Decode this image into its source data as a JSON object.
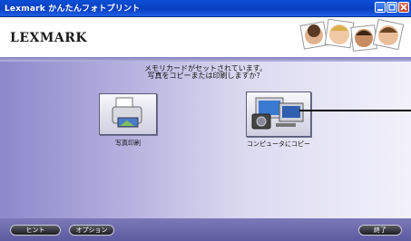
{
  "window": {
    "title": "Lexmark かんたんフォトプリント"
  },
  "header": {
    "logo": "LEXMARK"
  },
  "main": {
    "prompt_line1": "メモリカードがセットされています。",
    "prompt_line2": "写真をコピーまたは印刷しますか？",
    "options": [
      {
        "label": "写真印刷",
        "icon": "printer-icon"
      },
      {
        "label": "コンピュータにコピー",
        "icon": "computer-copy-icon"
      }
    ]
  },
  "footer": {
    "hint_label": "ヒント",
    "option_label": "オプション",
    "finish_label": "終了"
  },
  "colors": {
    "titlebar": "#0b3fc0",
    "panel_left": "#8c88cc",
    "panel_right": "#f2f1fb",
    "button": "#2a2a30"
  }
}
